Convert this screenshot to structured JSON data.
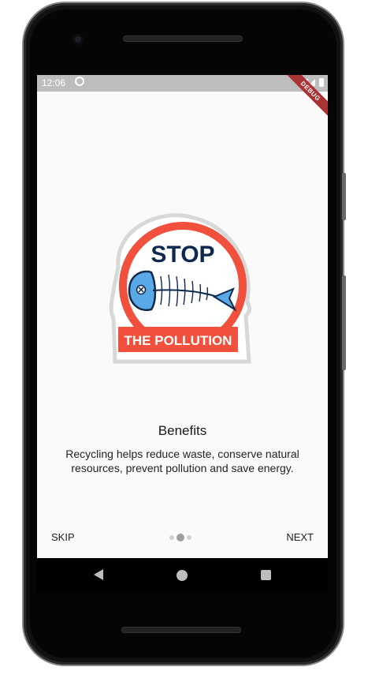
{
  "status_bar": {
    "time": "12:06",
    "debug_label": "DEBUG"
  },
  "onboarding": {
    "logo_top_text": "STOP",
    "logo_bottom_text": "THE POLLUTION",
    "title": "Benefits",
    "description": "Recycling helps reduce waste, conserve natural resources, prevent pollution and save energy.",
    "skip_label": "SKIP",
    "next_label": "NEXT",
    "page_indicator": {
      "count": 3,
      "active_index": 1
    }
  },
  "colors": {
    "logo_red": "#f0503c",
    "fish_blue": "#5aa9e6",
    "navy": "#0d2a4e",
    "screen_bg": "#fafafa",
    "status_bar_bg": "#bdbdbd"
  },
  "icons": [
    "sync-icon",
    "wifi-icon",
    "signal-icon",
    "battery-icon",
    "back-icon",
    "home-icon",
    "recents-icon"
  ]
}
